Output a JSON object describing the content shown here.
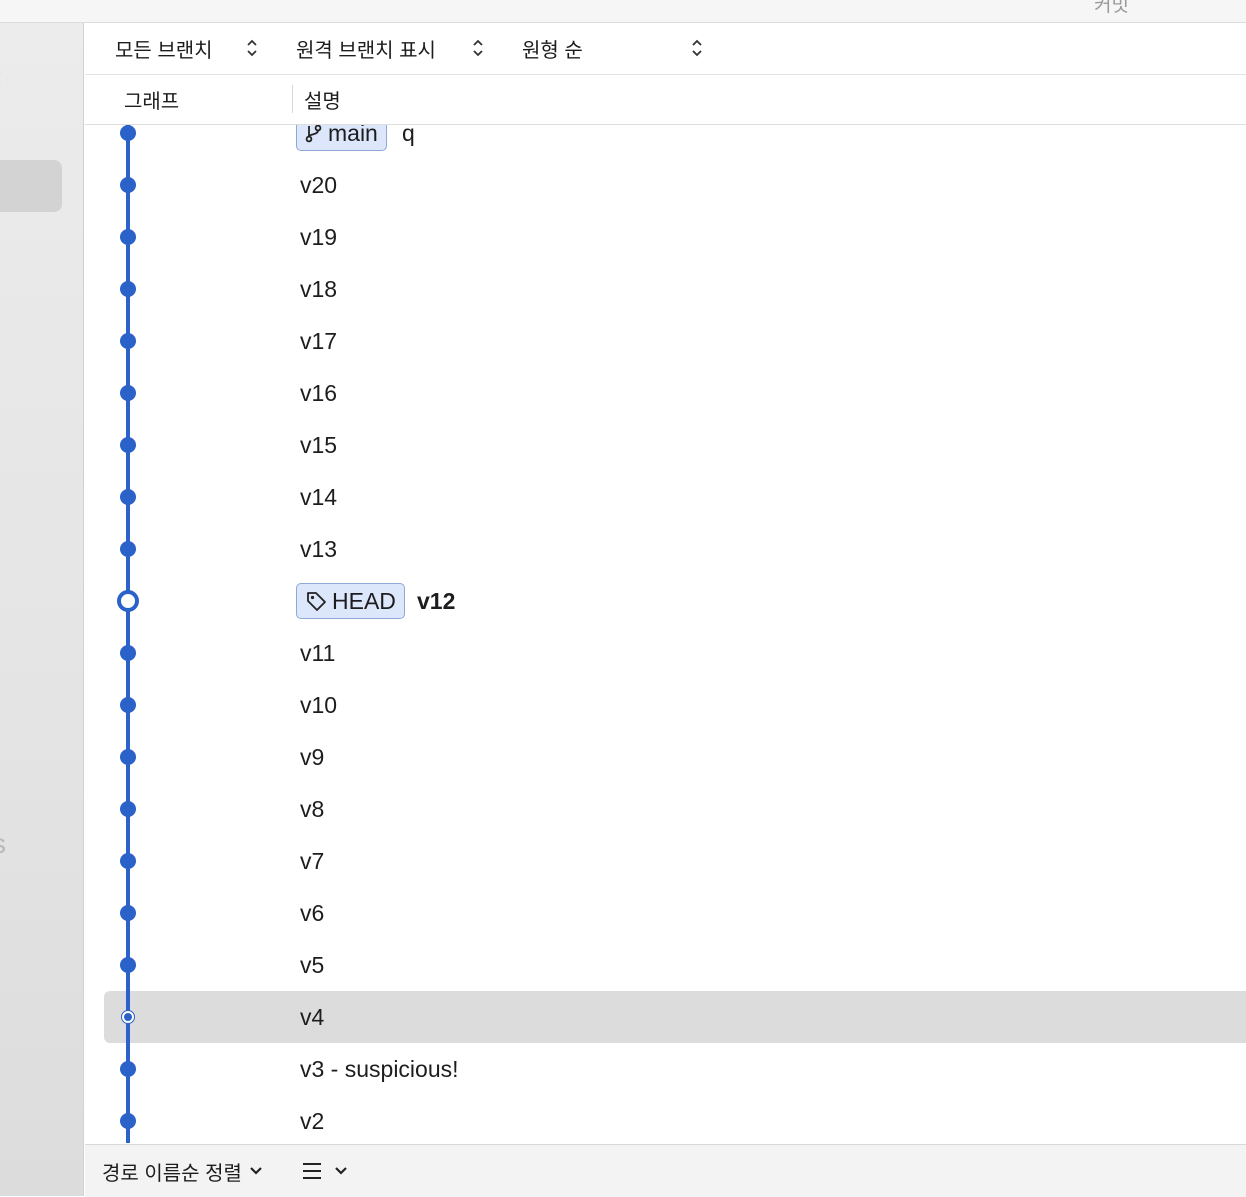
{
  "top_strip": {
    "title": "커밋"
  },
  "toolbar": {
    "branch_filter": "모든 브랜치",
    "remote_display": "원격 브랜치 표시",
    "order": "원형 순"
  },
  "columns": {
    "graph": "그래프",
    "description": "설명"
  },
  "commits": [
    {
      "text": "q",
      "badge": "main",
      "badge_icon": "branch-icon"
    },
    {
      "text": "v20"
    },
    {
      "text": "v19"
    },
    {
      "text": "v18"
    },
    {
      "text": "v17"
    },
    {
      "text": "v16"
    },
    {
      "text": "v15"
    },
    {
      "text": "v14"
    },
    {
      "text": "v13"
    },
    {
      "text": "v12",
      "badge": "HEAD",
      "badge_icon": "tag-icon",
      "bold": true
    },
    {
      "text": "v11"
    },
    {
      "text": "v10"
    },
    {
      "text": "v9"
    },
    {
      "text": "v8"
    },
    {
      "text": "v7"
    },
    {
      "text": "v6"
    },
    {
      "text": "v5"
    },
    {
      "text": "v4",
      "selected": true
    },
    {
      "text": "v3 - suspicious!"
    },
    {
      "text": "v2"
    }
  ],
  "bottom": {
    "sort_label": "경로 이름순 정렬"
  },
  "colors": {
    "graph": "#2a62c9",
    "badge_bg": "#dde7fb",
    "selection": "#dcdcdc"
  }
}
